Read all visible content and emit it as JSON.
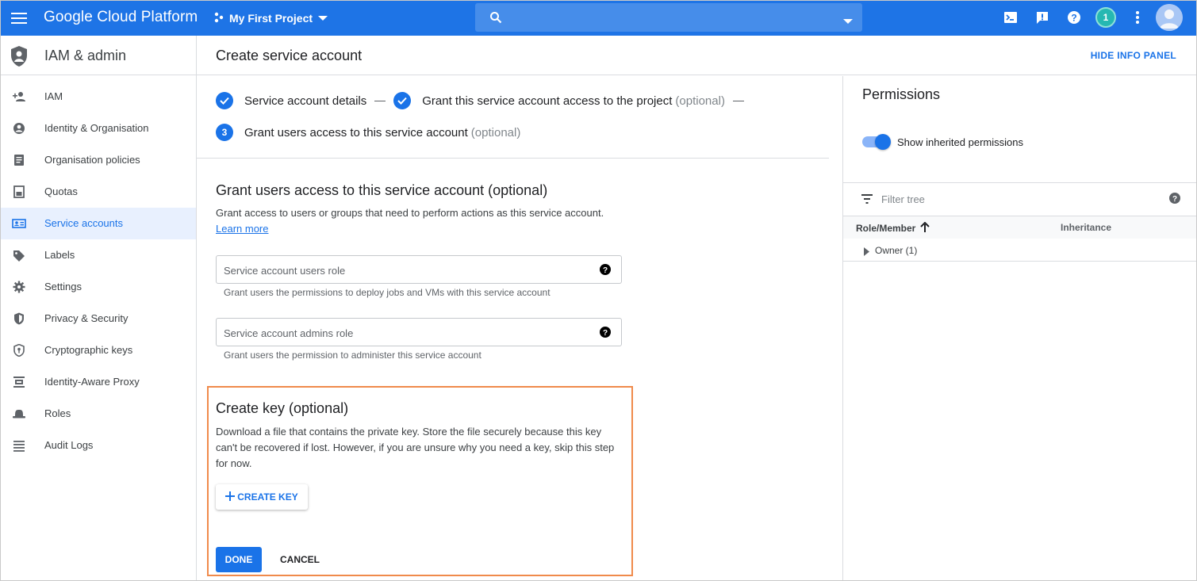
{
  "topbar": {
    "app_title": "Google Cloud Platform",
    "project_name": "My First Project",
    "search_placeholder": "",
    "notification_count": "1",
    "accent": "#1e74e6",
    "icons": [
      "menu-icon",
      "project-icon",
      "search-icon",
      "cloud-shell-icon",
      "feedback-icon",
      "help-icon",
      "more-vert-icon",
      "account-avatar"
    ]
  },
  "sidebar": {
    "title": "IAM & admin",
    "items": [
      {
        "label": "IAM",
        "icon": "person-add-icon"
      },
      {
        "label": "Identity & Organisation",
        "icon": "account-circle-icon"
      },
      {
        "label": "Organisation policies",
        "icon": "policy-doc-icon"
      },
      {
        "label": "Quotas",
        "icon": "quota-icon"
      },
      {
        "label": "Service accounts",
        "icon": "service-account-icon",
        "active": true
      },
      {
        "label": "Labels",
        "icon": "label-icon"
      },
      {
        "label": "Settings",
        "icon": "gear-icon"
      },
      {
        "label": "Privacy & Security",
        "icon": "shield-icon"
      },
      {
        "label": "Cryptographic keys",
        "icon": "key-shield-icon"
      },
      {
        "label": "Identity-Aware Proxy",
        "icon": "proxy-icon"
      },
      {
        "label": "Roles",
        "icon": "roles-hat-icon"
      },
      {
        "label": "Audit Logs",
        "icon": "list-icon"
      }
    ]
  },
  "header": {
    "title": "Create service account",
    "hide_info_panel": "HIDE INFO PANEL"
  },
  "stepper": {
    "step1": "Service account details",
    "step2": "Grant this service account access to the project",
    "step2_optional": "(optional)",
    "step3_number": "3",
    "step3": "Grant users access to this service account",
    "step3_optional": "(optional)"
  },
  "grant_section": {
    "title": "Grant users access to this service account (optional)",
    "description": "Grant access to users or groups that need to perform actions as this service account.",
    "learn_more": "Learn more",
    "users_role_placeholder": "Service account users role",
    "users_role_hint": "Grant users the permissions to deploy jobs and VMs with this service account",
    "admins_role_placeholder": "Service account admins role",
    "admins_role_hint": "Grant users the permission to administer this service account"
  },
  "key_section": {
    "title": "Create key (optional)",
    "description_line1": "Download a file that contains the private key. Store the file securely because this key",
    "description_line2": "can't be recovered if lost. However, if you are unsure why you need a key, skip this step",
    "description_line3": "for now.",
    "create_key": "CREATE KEY",
    "done": "DONE",
    "cancel": "CANCEL",
    "highlight_color": "#f08a4b"
  },
  "info_panel": {
    "title": "Permissions",
    "toggle_label": "Show inherited permissions",
    "toggle_on": true,
    "filter_placeholder": "Filter tree",
    "columns": [
      "Role/Member",
      "Inheritance"
    ],
    "rows": [
      {
        "label": "Owner (1)"
      }
    ]
  }
}
